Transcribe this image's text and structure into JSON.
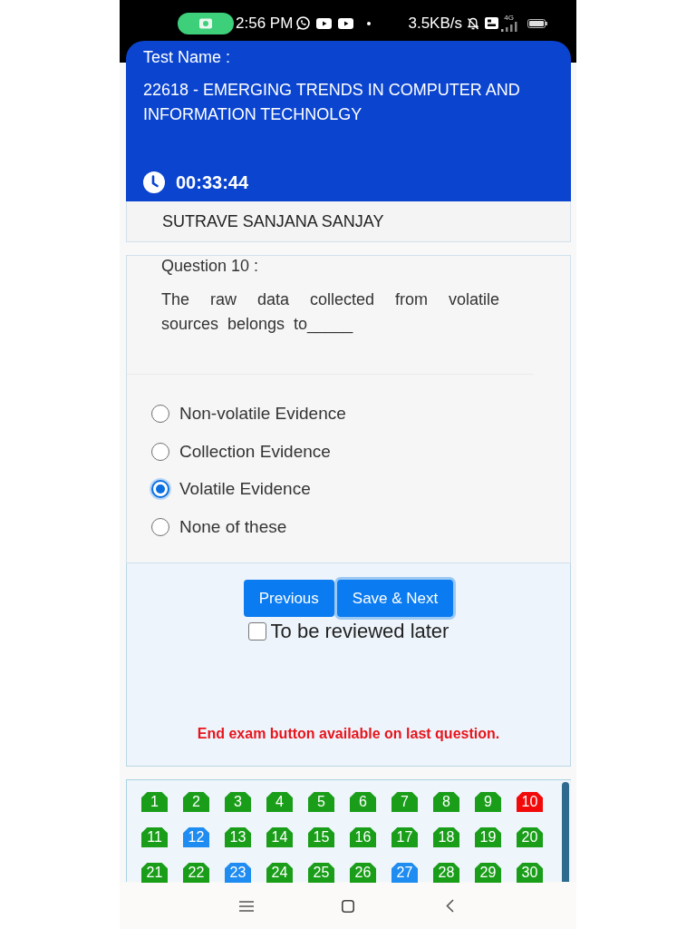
{
  "status_bar": {
    "time": "2:56 PM",
    "network_speed": "3.5KB/s",
    "network_type": "4G"
  },
  "header": {
    "label": "Test Name :",
    "test_name": "22618 - EMERGING TRENDS IN COMPUTER AND INFORMATION TECHNOLGY",
    "timer": "00:33:44"
  },
  "student_name": "SUTRAVE SANJANA SANJAY",
  "question": {
    "label": "Question 10 :",
    "text": "The raw data collected from volatile sources belongs to_____",
    "options": [
      {
        "label": "Non-volatile Evidence",
        "selected": false
      },
      {
        "label": "Collection Evidence",
        "selected": false
      },
      {
        "label": "Volatile Evidence",
        "selected": true
      },
      {
        "label": "None of these",
        "selected": false
      }
    ]
  },
  "actions": {
    "previous_button": {
      "label": "Previous",
      "focused": false
    },
    "save_next_button": {
      "label": "Save & Next",
      "focused": true
    },
    "review": {
      "label": "To be reviewed later",
      "checked": false
    },
    "notice": "End exam button available on last question."
  },
  "palette": {
    "tiles": [
      {
        "label": "1",
        "color": "#1a9e1a"
      },
      {
        "label": "2",
        "color": "#1a9e1a"
      },
      {
        "label": "3",
        "color": "#1a9e1a"
      },
      {
        "label": "4",
        "color": "#1a9e1a"
      },
      {
        "label": "5",
        "color": "#1a9e1a"
      },
      {
        "label": "6",
        "color": "#1a9e1a"
      },
      {
        "label": "7",
        "color": "#1a9e1a"
      },
      {
        "label": "8",
        "color": "#1a9e1a"
      },
      {
        "label": "9",
        "color": "#1a9e1a"
      },
      {
        "label": "10",
        "color": "#f20a0a"
      },
      {
        "label": "11",
        "color": "#1a9e1a"
      },
      {
        "label": "12",
        "color": "#1e8cf0"
      },
      {
        "label": "13",
        "color": "#1a9e1a"
      },
      {
        "label": "14",
        "color": "#1a9e1a"
      },
      {
        "label": "15",
        "color": "#1a9e1a"
      },
      {
        "label": "16",
        "color": "#1a9e1a"
      },
      {
        "label": "17",
        "color": "#1a9e1a"
      },
      {
        "label": "18",
        "color": "#1a9e1a"
      },
      {
        "label": "19",
        "color": "#1a9e1a"
      },
      {
        "label": "20",
        "color": "#1a9e1a"
      },
      {
        "label": "21",
        "color": "#1a9e1a"
      },
      {
        "label": "22",
        "color": "#1a9e1a"
      },
      {
        "label": "23",
        "color": "#1e8cf0"
      },
      {
        "label": "24",
        "color": "#1a9e1a"
      },
      {
        "label": "25",
        "color": "#1a9e1a"
      },
      {
        "label": "26",
        "color": "#1a9e1a"
      },
      {
        "label": "27",
        "color": "#1e8cf0"
      },
      {
        "label": "28",
        "color": "#1a9e1a"
      },
      {
        "label": "29",
        "color": "#1a9e1a"
      },
      {
        "label": "30",
        "color": "#1a9e1a"
      }
    ]
  }
}
